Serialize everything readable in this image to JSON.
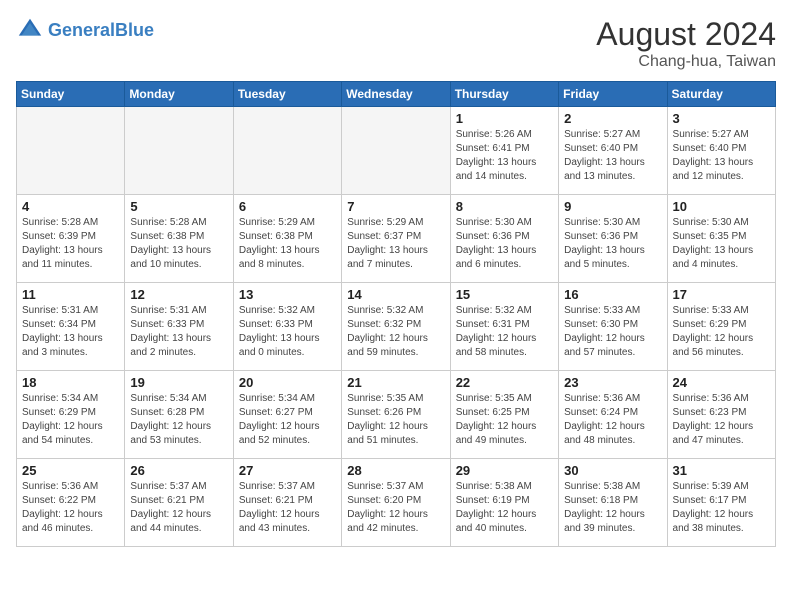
{
  "header": {
    "logo_general": "General",
    "logo_blue": "Blue",
    "month_year": "August 2024",
    "location": "Chang-hua, Taiwan"
  },
  "weekdays": [
    "Sunday",
    "Monday",
    "Tuesday",
    "Wednesday",
    "Thursday",
    "Friday",
    "Saturday"
  ],
  "weeks": [
    [
      {
        "day": "",
        "info": "",
        "empty": true
      },
      {
        "day": "",
        "info": "",
        "empty": true
      },
      {
        "day": "",
        "info": "",
        "empty": true
      },
      {
        "day": "",
        "info": "",
        "empty": true
      },
      {
        "day": "1",
        "info": "Sunrise: 5:26 AM\nSunset: 6:41 PM\nDaylight: 13 hours\nand 14 minutes."
      },
      {
        "day": "2",
        "info": "Sunrise: 5:27 AM\nSunset: 6:40 PM\nDaylight: 13 hours\nand 13 minutes."
      },
      {
        "day": "3",
        "info": "Sunrise: 5:27 AM\nSunset: 6:40 PM\nDaylight: 13 hours\nand 12 minutes."
      }
    ],
    [
      {
        "day": "4",
        "info": "Sunrise: 5:28 AM\nSunset: 6:39 PM\nDaylight: 13 hours\nand 11 minutes."
      },
      {
        "day": "5",
        "info": "Sunrise: 5:28 AM\nSunset: 6:38 PM\nDaylight: 13 hours\nand 10 minutes."
      },
      {
        "day": "6",
        "info": "Sunrise: 5:29 AM\nSunset: 6:38 PM\nDaylight: 13 hours\nand 8 minutes."
      },
      {
        "day": "7",
        "info": "Sunrise: 5:29 AM\nSunset: 6:37 PM\nDaylight: 13 hours\nand 7 minutes."
      },
      {
        "day": "8",
        "info": "Sunrise: 5:30 AM\nSunset: 6:36 PM\nDaylight: 13 hours\nand 6 minutes."
      },
      {
        "day": "9",
        "info": "Sunrise: 5:30 AM\nSunset: 6:36 PM\nDaylight: 13 hours\nand 5 minutes."
      },
      {
        "day": "10",
        "info": "Sunrise: 5:30 AM\nSunset: 6:35 PM\nDaylight: 13 hours\nand 4 minutes."
      }
    ],
    [
      {
        "day": "11",
        "info": "Sunrise: 5:31 AM\nSunset: 6:34 PM\nDaylight: 13 hours\nand 3 minutes."
      },
      {
        "day": "12",
        "info": "Sunrise: 5:31 AM\nSunset: 6:33 PM\nDaylight: 13 hours\nand 2 minutes."
      },
      {
        "day": "13",
        "info": "Sunrise: 5:32 AM\nSunset: 6:33 PM\nDaylight: 13 hours\nand 0 minutes."
      },
      {
        "day": "14",
        "info": "Sunrise: 5:32 AM\nSunset: 6:32 PM\nDaylight: 12 hours\nand 59 minutes."
      },
      {
        "day": "15",
        "info": "Sunrise: 5:32 AM\nSunset: 6:31 PM\nDaylight: 12 hours\nand 58 minutes."
      },
      {
        "day": "16",
        "info": "Sunrise: 5:33 AM\nSunset: 6:30 PM\nDaylight: 12 hours\nand 57 minutes."
      },
      {
        "day": "17",
        "info": "Sunrise: 5:33 AM\nSunset: 6:29 PM\nDaylight: 12 hours\nand 56 minutes."
      }
    ],
    [
      {
        "day": "18",
        "info": "Sunrise: 5:34 AM\nSunset: 6:29 PM\nDaylight: 12 hours\nand 54 minutes."
      },
      {
        "day": "19",
        "info": "Sunrise: 5:34 AM\nSunset: 6:28 PM\nDaylight: 12 hours\nand 53 minutes."
      },
      {
        "day": "20",
        "info": "Sunrise: 5:34 AM\nSunset: 6:27 PM\nDaylight: 12 hours\nand 52 minutes."
      },
      {
        "day": "21",
        "info": "Sunrise: 5:35 AM\nSunset: 6:26 PM\nDaylight: 12 hours\nand 51 minutes."
      },
      {
        "day": "22",
        "info": "Sunrise: 5:35 AM\nSunset: 6:25 PM\nDaylight: 12 hours\nand 49 minutes."
      },
      {
        "day": "23",
        "info": "Sunrise: 5:36 AM\nSunset: 6:24 PM\nDaylight: 12 hours\nand 48 minutes."
      },
      {
        "day": "24",
        "info": "Sunrise: 5:36 AM\nSunset: 6:23 PM\nDaylight: 12 hours\nand 47 minutes."
      }
    ],
    [
      {
        "day": "25",
        "info": "Sunrise: 5:36 AM\nSunset: 6:22 PM\nDaylight: 12 hours\nand 46 minutes."
      },
      {
        "day": "26",
        "info": "Sunrise: 5:37 AM\nSunset: 6:21 PM\nDaylight: 12 hours\nand 44 minutes."
      },
      {
        "day": "27",
        "info": "Sunrise: 5:37 AM\nSunset: 6:21 PM\nDaylight: 12 hours\nand 43 minutes."
      },
      {
        "day": "28",
        "info": "Sunrise: 5:37 AM\nSunset: 6:20 PM\nDaylight: 12 hours\nand 42 minutes."
      },
      {
        "day": "29",
        "info": "Sunrise: 5:38 AM\nSunset: 6:19 PM\nDaylight: 12 hours\nand 40 minutes."
      },
      {
        "day": "30",
        "info": "Sunrise: 5:38 AM\nSunset: 6:18 PM\nDaylight: 12 hours\nand 39 minutes."
      },
      {
        "day": "31",
        "info": "Sunrise: 5:39 AM\nSunset: 6:17 PM\nDaylight: 12 hours\nand 38 minutes."
      }
    ]
  ]
}
